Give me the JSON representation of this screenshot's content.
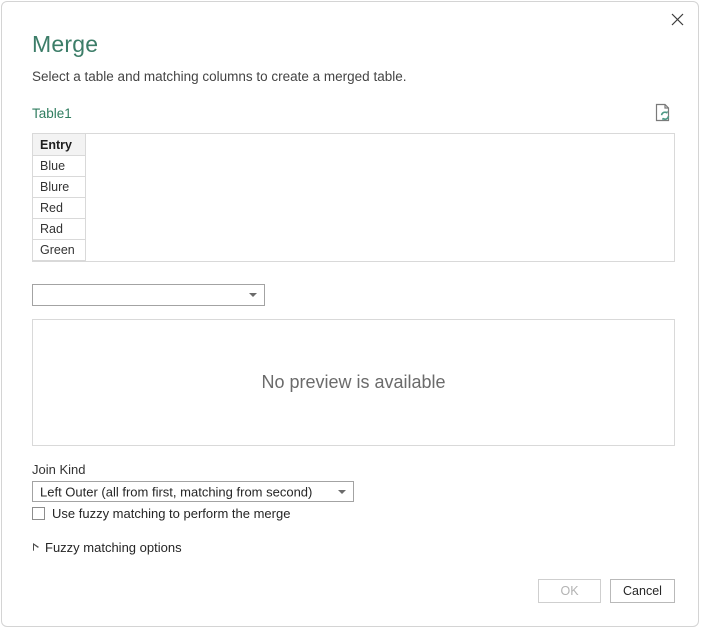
{
  "dialog": {
    "title": "Merge",
    "subtitle": "Select a table and matching columns to create a merged table.",
    "close_icon": "close-icon"
  },
  "first_table": {
    "label": "Table1",
    "refresh_icon": "page-refresh-icon",
    "columns": [
      "Entry"
    ],
    "rows": [
      [
        "Blue"
      ],
      [
        "Blure"
      ],
      [
        "Red"
      ],
      [
        "Rad"
      ],
      [
        "Green"
      ]
    ]
  },
  "second_table_select": {
    "value": "",
    "placeholder": "",
    "caret_icon": "chevron-down-icon"
  },
  "preview": {
    "message": "No preview is available"
  },
  "join_kind": {
    "label": "Join Kind",
    "value": "Left Outer (all from first, matching from second)",
    "caret_icon": "chevron-down-icon"
  },
  "fuzzy": {
    "checkbox_label": "Use fuzzy matching to perform the merge",
    "checked": false,
    "expander_label": "Fuzzy matching options",
    "expander_icon": "triangle-right-icon",
    "expanded": false
  },
  "footer": {
    "ok_label": "OK",
    "ok_enabled": false,
    "cancel_label": "Cancel",
    "cancel_enabled": true
  },
  "colors": {
    "accent_title": "#3c7d68",
    "accent_table_label": "#2f7d5f",
    "border": "#d9d9d9",
    "header_bg": "#f3f3f3",
    "preview_text": "#6b6b6b",
    "disabled_text": "#b3b3b3",
    "icon_green": "#4e9a86"
  }
}
